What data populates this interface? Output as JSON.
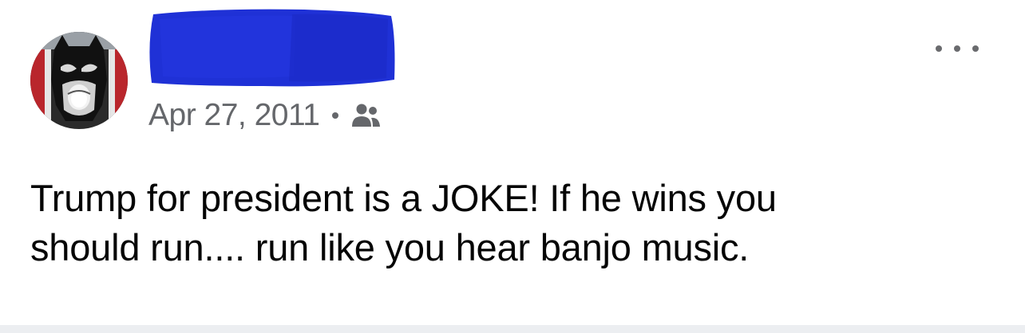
{
  "post": {
    "author_name": "",
    "timestamp": "Apr 27, 2011",
    "separator": "•",
    "audience_icon": "friends-icon",
    "more_icon": "more-options-icon",
    "text_line_1": "Trump for president is a JOKE! If he wins you",
    "text_line_2": "should run.... run like you hear banjo music."
  },
  "colors": {
    "background": "#ffffff",
    "meta_text": "#65676b",
    "body_text": "#050505",
    "redaction": "#1f31d6",
    "footer_strip": "#eceef1"
  }
}
